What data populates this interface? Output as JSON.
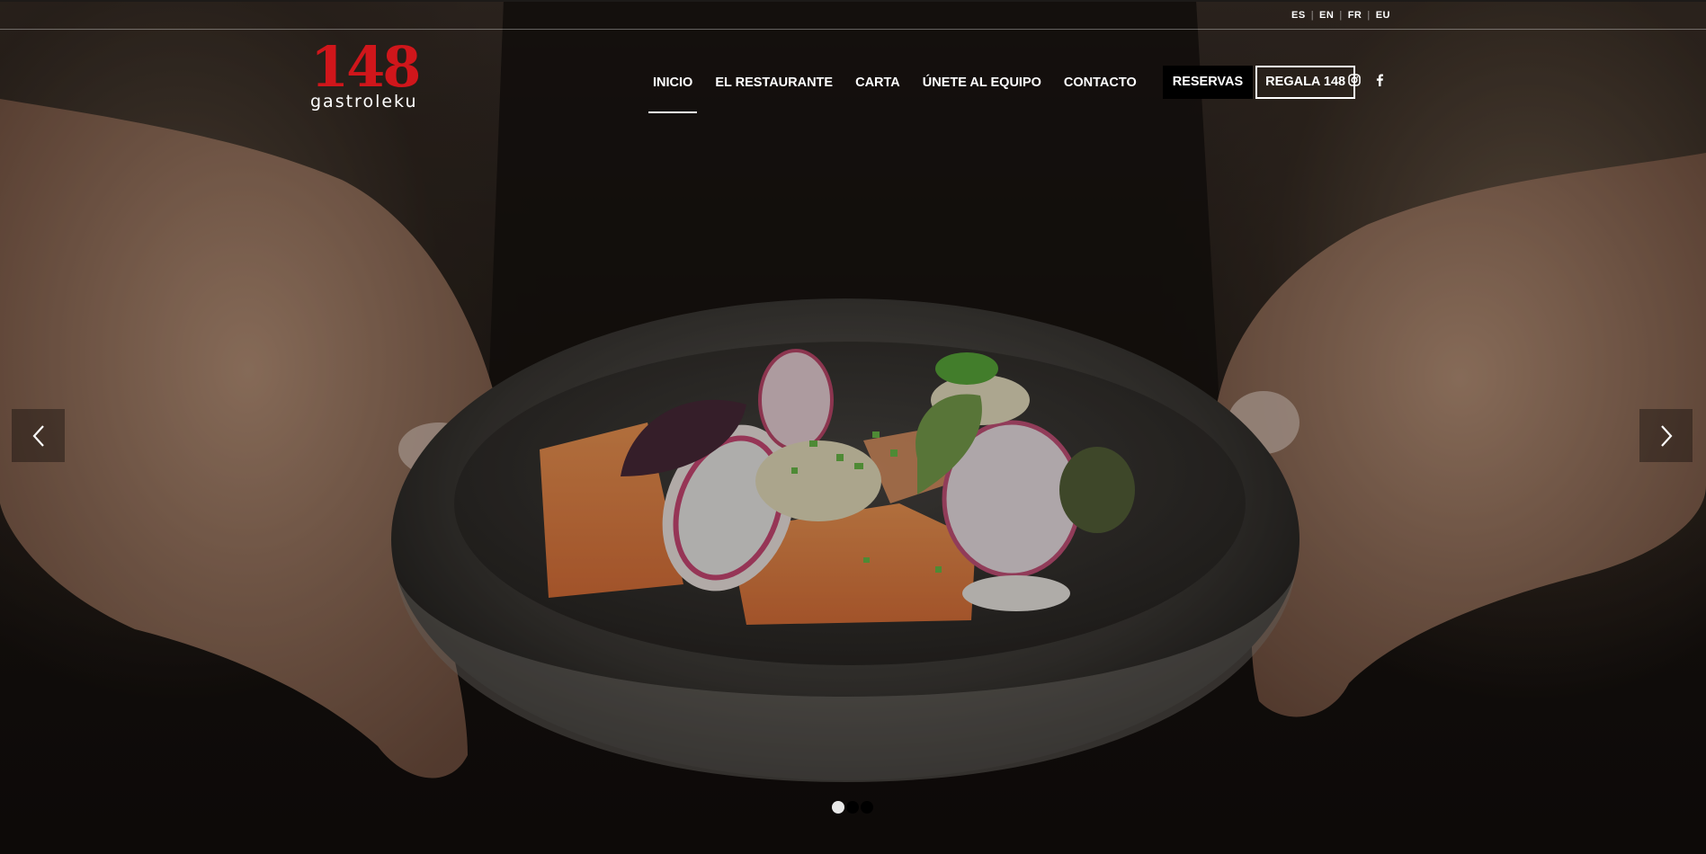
{
  "languages": [
    "ES",
    "EN",
    "FR",
    "EU"
  ],
  "logo": {
    "number": "148",
    "name": "gastroleku",
    "brand_color": "#d0161b"
  },
  "nav": {
    "items": [
      {
        "label": "INICIO",
        "active": true
      },
      {
        "label": "EL RESTAURANTE",
        "active": false
      },
      {
        "label": "CARTA",
        "active": false
      },
      {
        "label": "ÚNETE AL EQUIPO",
        "active": false
      },
      {
        "label": "CONTACTO",
        "active": false
      }
    ],
    "reservas_label": "RESERVAS",
    "regala_label": "REGALA 148"
  },
  "social": [
    "instagram-icon",
    "facebook-icon"
  ],
  "slider": {
    "image": "chef hands holding a plate of salmon with radish and herbs",
    "slide_count": 3,
    "active_slide": 1
  }
}
